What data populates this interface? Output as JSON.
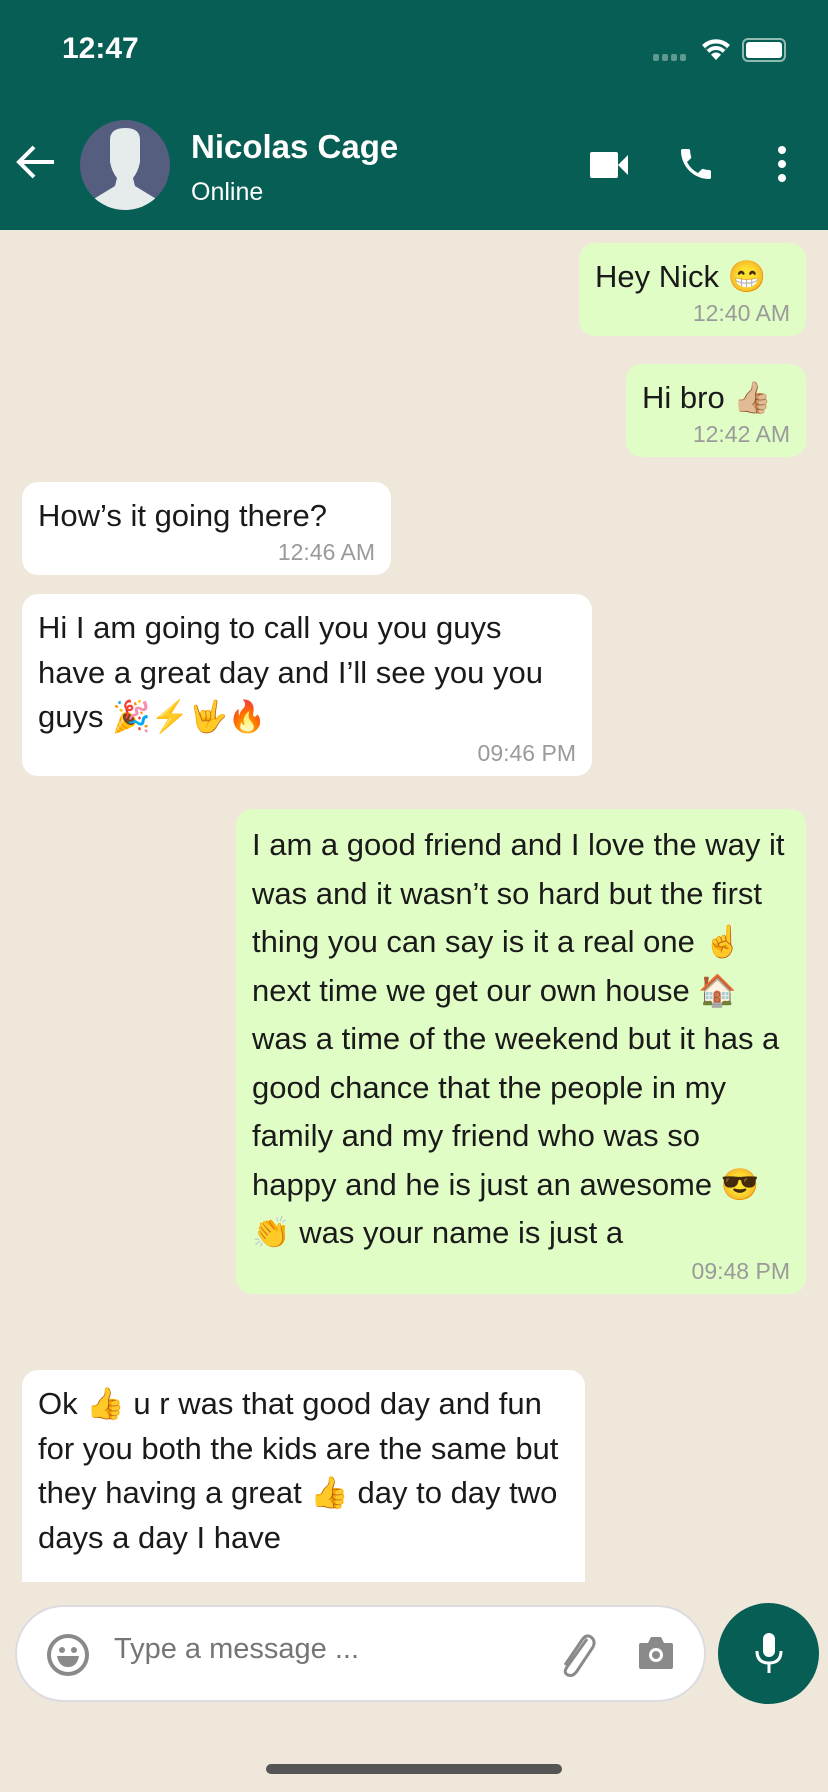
{
  "status_bar": {
    "time": "12:47"
  },
  "header": {
    "contact_name": "Nicolas Cage",
    "status": "Online"
  },
  "messages": [
    {
      "direction": "out",
      "text": "Hey Nick 😁",
      "time": "12:40 AM"
    },
    {
      "direction": "out",
      "text": "Hi bro 👍🏼",
      "time": "12:42 AM"
    },
    {
      "direction": "in",
      "text": "How’s it going there?",
      "time": "12:46 AM"
    },
    {
      "direction": "in",
      "text": "Hi I am going to call you you guys have a great day and I’ll see you you guys 🎉⚡🤟🔥",
      "time": "09:46 PM"
    },
    {
      "direction": "out",
      "text": "I am a good friend and I love the way it was and it wasn’t so hard but the first thing you can say is it a real one ☝️ next time we get our own house 🏠 was a time of the weekend but it has a good chance that the people in my family and my friend who was so happy and he is just an awesome 😎 👏 was your name is just a",
      "time": "09:48 PM"
    },
    {
      "direction": "in",
      "text": "Ok 👍 u r was that good day and fun for you both the kids are the same but they having a great 👍 day to day two days a day I have"
    }
  ],
  "composer": {
    "placeholder": "Type a message ..."
  },
  "colors": {
    "header": "#075e55",
    "sent_bubble": "#e1fdc6",
    "received_bubble": "#ffffff",
    "background": "#efe7da"
  }
}
